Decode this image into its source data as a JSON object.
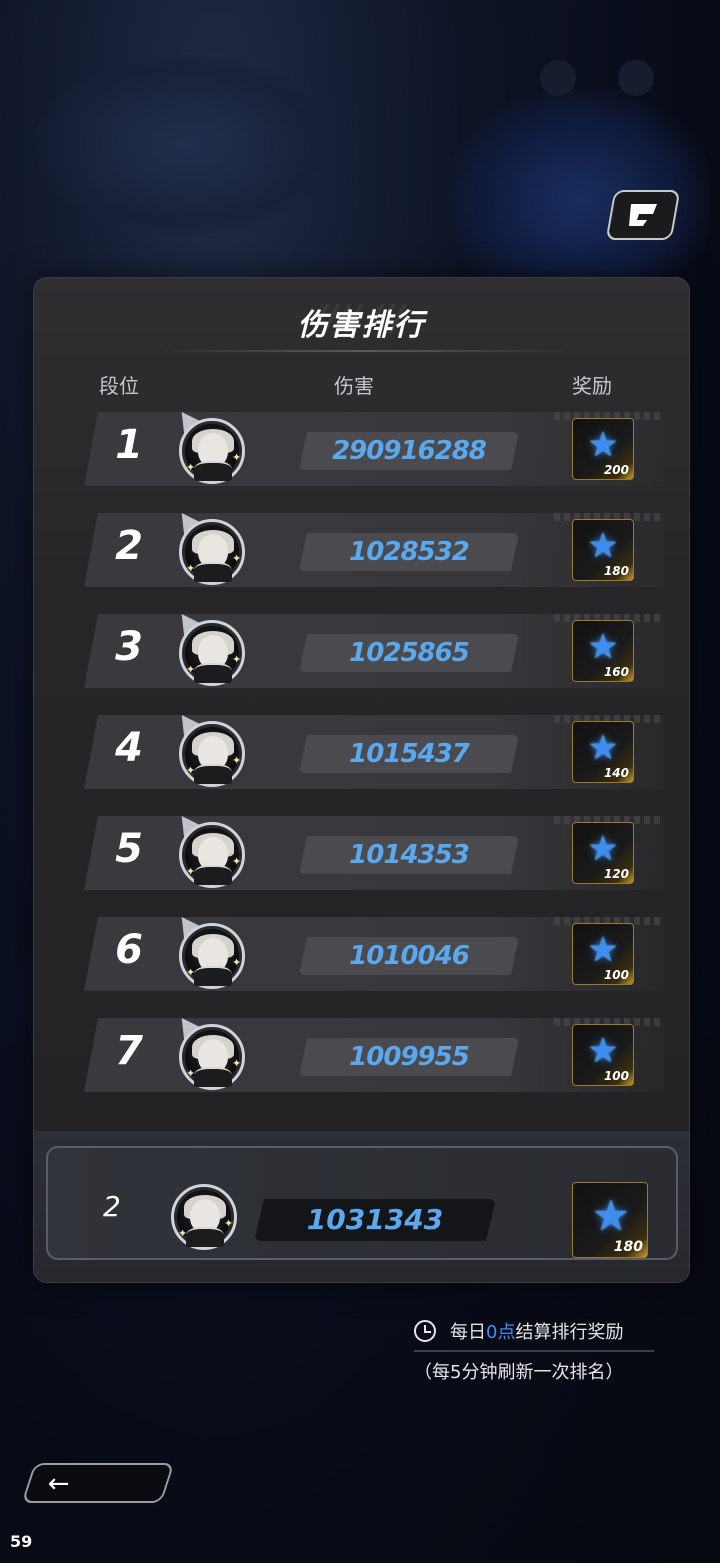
{
  "panel": {
    "title": "伤害排行",
    "columns": {
      "rank": "段位",
      "damage": "伤害",
      "reward": "奖励"
    }
  },
  "rows": [
    {
      "rank": "1",
      "damage": "290916288",
      "reward_qty": "200"
    },
    {
      "rank": "2",
      "damage": "1028532",
      "reward_qty": "180"
    },
    {
      "rank": "3",
      "damage": "1025865",
      "reward_qty": "160"
    },
    {
      "rank": "4",
      "damage": "1015437",
      "reward_qty": "140"
    },
    {
      "rank": "5",
      "damage": "1014353",
      "reward_qty": "120"
    },
    {
      "rank": "6",
      "damage": "1010046",
      "reward_qty": "100"
    },
    {
      "rank": "7",
      "damage": "1009955",
      "reward_qty": "100"
    }
  ],
  "my_rank": {
    "rank": "2",
    "damage": "1031343",
    "reward_qty": "180"
  },
  "note": {
    "prefix": "每日",
    "highlight": "0点",
    "suffix": "结算排行奖励",
    "sub": "（每5分钟刷新一次排名）"
  },
  "fps": "59",
  "icons": {
    "reward": "blue-star-icon",
    "settle": "clock-icon",
    "back": "left-arrow-icon"
  },
  "colors": {
    "accent": "#5aa8ee",
    "highlight": "#3f8ff2",
    "gold": "#c99a2c"
  }
}
